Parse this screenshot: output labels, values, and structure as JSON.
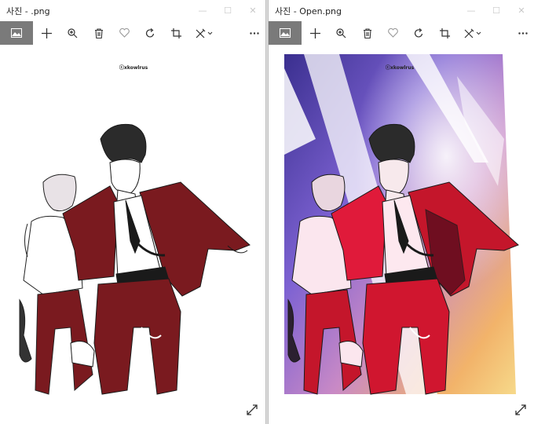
{
  "windows": [
    {
      "title": "사진 - .png",
      "watermark": "ⓒxkowlrus",
      "variant": "lineart"
    },
    {
      "title": "사진 - Open.png",
      "watermark": "ⓒxkowlrus",
      "variant": "colored"
    }
  ],
  "window_controls": [
    "minimize-icon",
    "maximize-icon",
    "close-icon"
  ],
  "toolbar": {
    "icons": [
      "image-icon",
      "add-icon",
      "zoom-in-icon",
      "delete-icon",
      "heart-icon",
      "rotate-icon",
      "crop-icon",
      "edit-icon",
      "more-icon"
    ]
  },
  "colors": {
    "suit": "#7a1a1f",
    "suit_colored": "#c4162b",
    "hair": "#2b2b2b",
    "view_button": "#7a7a7a",
    "background_sky": "#6b5bc8"
  }
}
